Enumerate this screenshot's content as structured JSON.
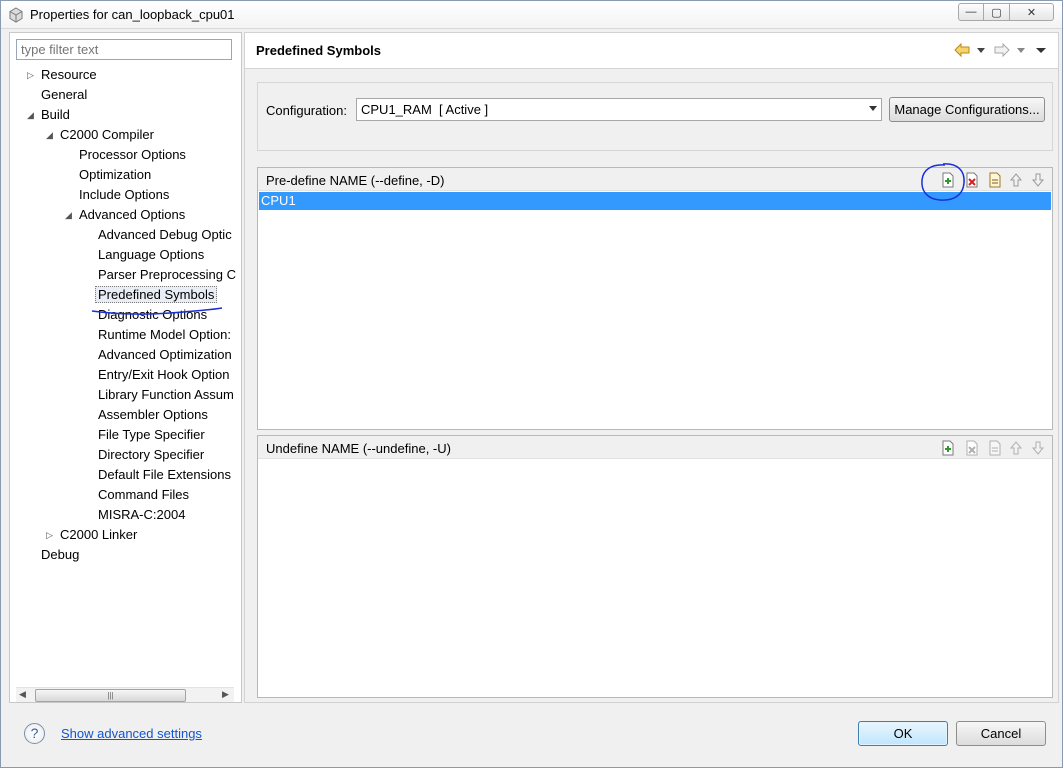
{
  "window": {
    "title": "Properties for can_loopback_cpu01",
    "controls": {
      "minimize": "—",
      "maximize": "▢",
      "close": "✕"
    }
  },
  "filter": {
    "placeholder": "type filter text",
    "value": ""
  },
  "tree": [
    {
      "label": "Resource",
      "state": "collapsed"
    },
    {
      "label": "General"
    },
    {
      "label": "Build",
      "state": "expanded"
    },
    {
      "label": "C2000 Compiler",
      "state": "expanded"
    },
    {
      "label": "Processor Options"
    },
    {
      "label": "Optimization"
    },
    {
      "label": "Include Options"
    },
    {
      "label": "Advanced Options",
      "state": "expanded"
    },
    {
      "label": "Advanced Debug Optic"
    },
    {
      "label": "Language Options"
    },
    {
      "label": "Parser Preprocessing C"
    },
    {
      "label": "Predefined Symbols",
      "selected": true
    },
    {
      "label": "Diagnostic Options"
    },
    {
      "label": "Runtime Model Option:"
    },
    {
      "label": "Advanced Optimization"
    },
    {
      "label": "Entry/Exit Hook Option"
    },
    {
      "label": "Library Function Assum"
    },
    {
      "label": "Assembler Options"
    },
    {
      "label": "File Type Specifier"
    },
    {
      "label": "Directory Specifier"
    },
    {
      "label": "Default File Extensions"
    },
    {
      "label": "Command Files"
    },
    {
      "label": "MISRA-C:2004"
    },
    {
      "label": "C2000 Linker",
      "state": "collapsed"
    },
    {
      "label": "Debug"
    }
  ],
  "page": {
    "title": "Predefined Symbols"
  },
  "configuration": {
    "label": "Configuration:",
    "selected": "CPU1_RAM  [ Active ]",
    "manage_label": "Manage Configurations..."
  },
  "predefine": {
    "title": "Pre-define NAME (--define, -D)",
    "items": [
      "CPU1"
    ]
  },
  "undefine": {
    "title": "Undefine NAME (--undefine, -U)",
    "items": []
  },
  "icons": {
    "add": "add-icon",
    "delete": "delete-icon",
    "edit": "edit-icon",
    "move_up": "move-up-icon",
    "move_down": "move-down-icon",
    "help": "help-icon"
  },
  "colors": {
    "selection": "#3399ff",
    "link": "#1155cc",
    "annotation": "#1a2fd6"
  },
  "footer": {
    "help_glyph": "?",
    "advanced_link": "Show advanced settings",
    "ok_label": "OK",
    "cancel_label": "Cancel"
  }
}
